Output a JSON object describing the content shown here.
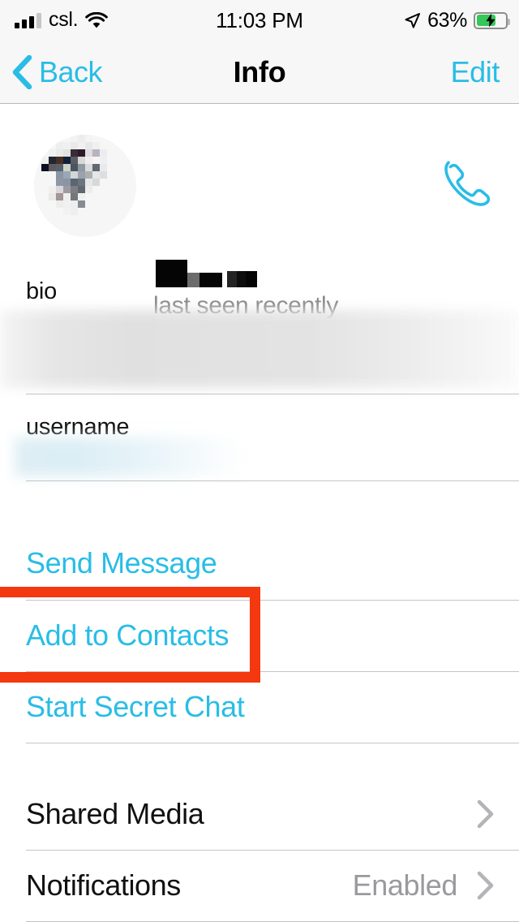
{
  "status_bar": {
    "carrier": "csl.",
    "time": "11:03 PM",
    "battery_percent": "63%",
    "battery_level": 63,
    "charging": true,
    "signal_bars_filled": 3,
    "signal_bars_total": 4,
    "wifi": "wifi-icon",
    "location": "location-arrow-icon"
  },
  "nav_bar": {
    "back_label": "Back",
    "title": "Info",
    "edit_label": "Edit"
  },
  "profile": {
    "name": "",
    "name_redacted": true,
    "presence": "last seen recently",
    "avatar": "pixelated-avatar",
    "call_icon": "phone-icon"
  },
  "bio": {
    "label": "bio",
    "value": "",
    "blurred": true
  },
  "username": {
    "label": "username",
    "value": "",
    "blurred": true
  },
  "actions": [
    {
      "label": "Send Message"
    },
    {
      "label": "Add to Contacts"
    },
    {
      "label": "Start Secret Chat"
    }
  ],
  "settings": [
    {
      "label": "Shared Media",
      "value": "",
      "chevron": "chevron-right-icon"
    },
    {
      "label": "Notifications",
      "value": "Enabled",
      "chevron": "chevron-right-icon"
    }
  ],
  "highlight": {
    "target": "Add to Contacts",
    "color": "#f4380f"
  },
  "colors": {
    "accent": "#29bde6",
    "highlight": "#f4380f",
    "separator": "#c4c4c4",
    "nav_background": "#f7f7f7",
    "secondary_text": "#8a8a8e",
    "battery_green": "#34c759"
  }
}
